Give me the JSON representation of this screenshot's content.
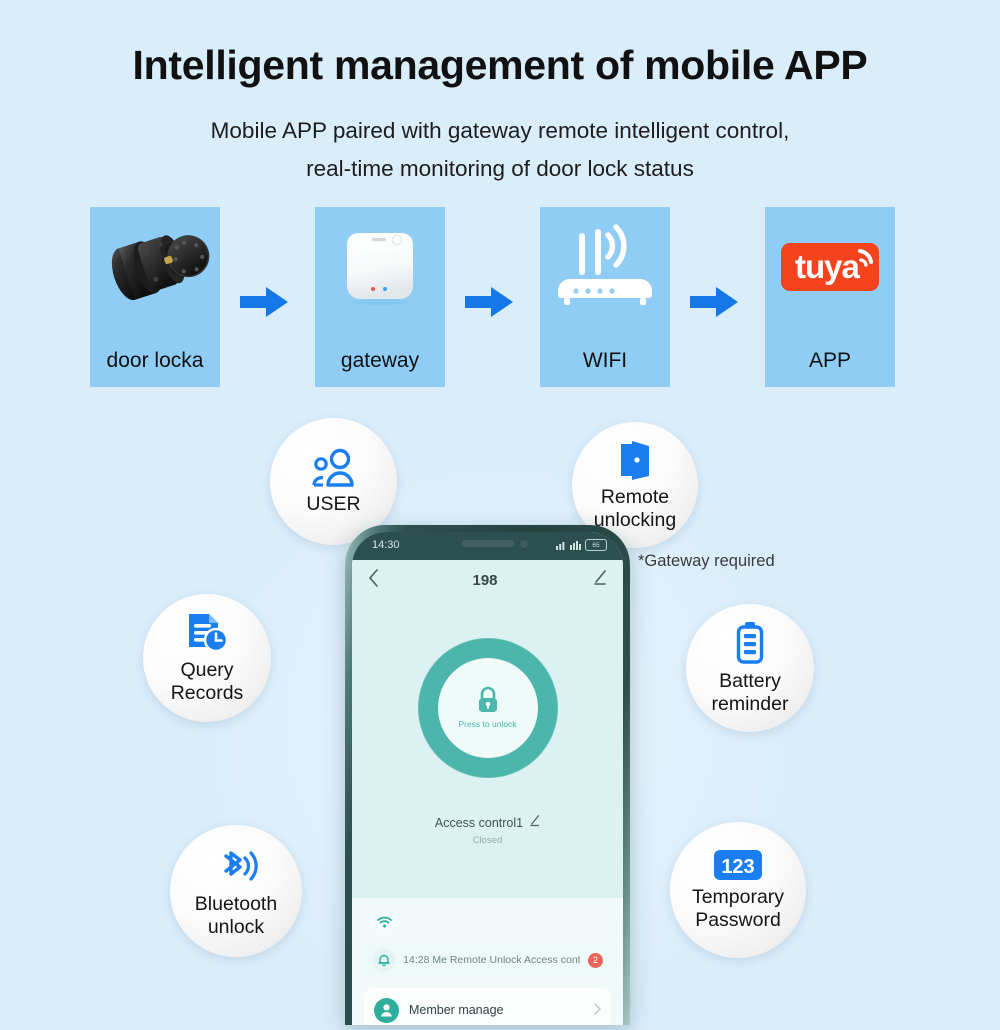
{
  "page": {
    "title": "Intelligent management of mobile APP",
    "subtitle_line1": "Mobile APP paired with gateway remote intelligent control,",
    "subtitle_line2": "real-time monitoring of door lock status",
    "background_color": "#daedfb",
    "accent_blue": "#1677e8",
    "card_blue": "#8fcdf5",
    "teal": "#4cb5ac",
    "tuya_orange": "#f5431e"
  },
  "flow": {
    "cards": [
      {
        "label": "door locka",
        "icon": "door-lock-cylinder-icon"
      },
      {
        "label": "gateway",
        "icon": "gateway-hub-icon"
      },
      {
        "label": "WIFI",
        "icon": "wifi-router-icon"
      },
      {
        "label": "APP",
        "icon": "tuya-logo-icon"
      }
    ],
    "arrows": [
      "arrow-right-icon",
      "arrow-right-icon",
      "arrow-right-icon"
    ],
    "tuya_wordmark": "tuya"
  },
  "features": [
    {
      "id": "user",
      "icon": "users-icon",
      "line1": "USER",
      "line2": ""
    },
    {
      "id": "remote",
      "icon": "open-door-icon",
      "line1": "Remote",
      "line2": "unlocking"
    },
    {
      "id": "query",
      "icon": "document-clock-icon",
      "line1": "Query",
      "line2": "Records"
    },
    {
      "id": "battery",
      "icon": "battery-icon",
      "line1": "Battery",
      "line2": "reminder"
    },
    {
      "id": "bluetooth",
      "icon": "bluetooth-signal-icon",
      "line1": "Bluetooth",
      "line2": "unlock"
    },
    {
      "id": "temporary",
      "icon": "numeric-123-icon",
      "line1": "Temporary",
      "line2": "Password"
    }
  ],
  "gateway_note": "*Gateway required",
  "temp_password_digits": "123",
  "phone": {
    "status_bar": {
      "time": "14:30",
      "battery_level": "65"
    },
    "app_header": {
      "back_icon": "chevron-left-icon",
      "title": "198",
      "edit_icon": "pencil-icon"
    },
    "lock_button": {
      "icon": "padlock-icon",
      "label": "Press to unlock"
    },
    "device": {
      "name": "Access control1",
      "edit_icon": "pencil-icon",
      "status": "Closed"
    },
    "wifi_chip_icon": "wifi-icon",
    "notification": {
      "icon": "bell-icon",
      "text": "14:28 Me  Remote Unlock Access cont..",
      "badge": "2"
    },
    "member_row": {
      "icon": "person-avatar-icon",
      "label": "Member manage",
      "chevron": "chevron-right-icon"
    }
  }
}
